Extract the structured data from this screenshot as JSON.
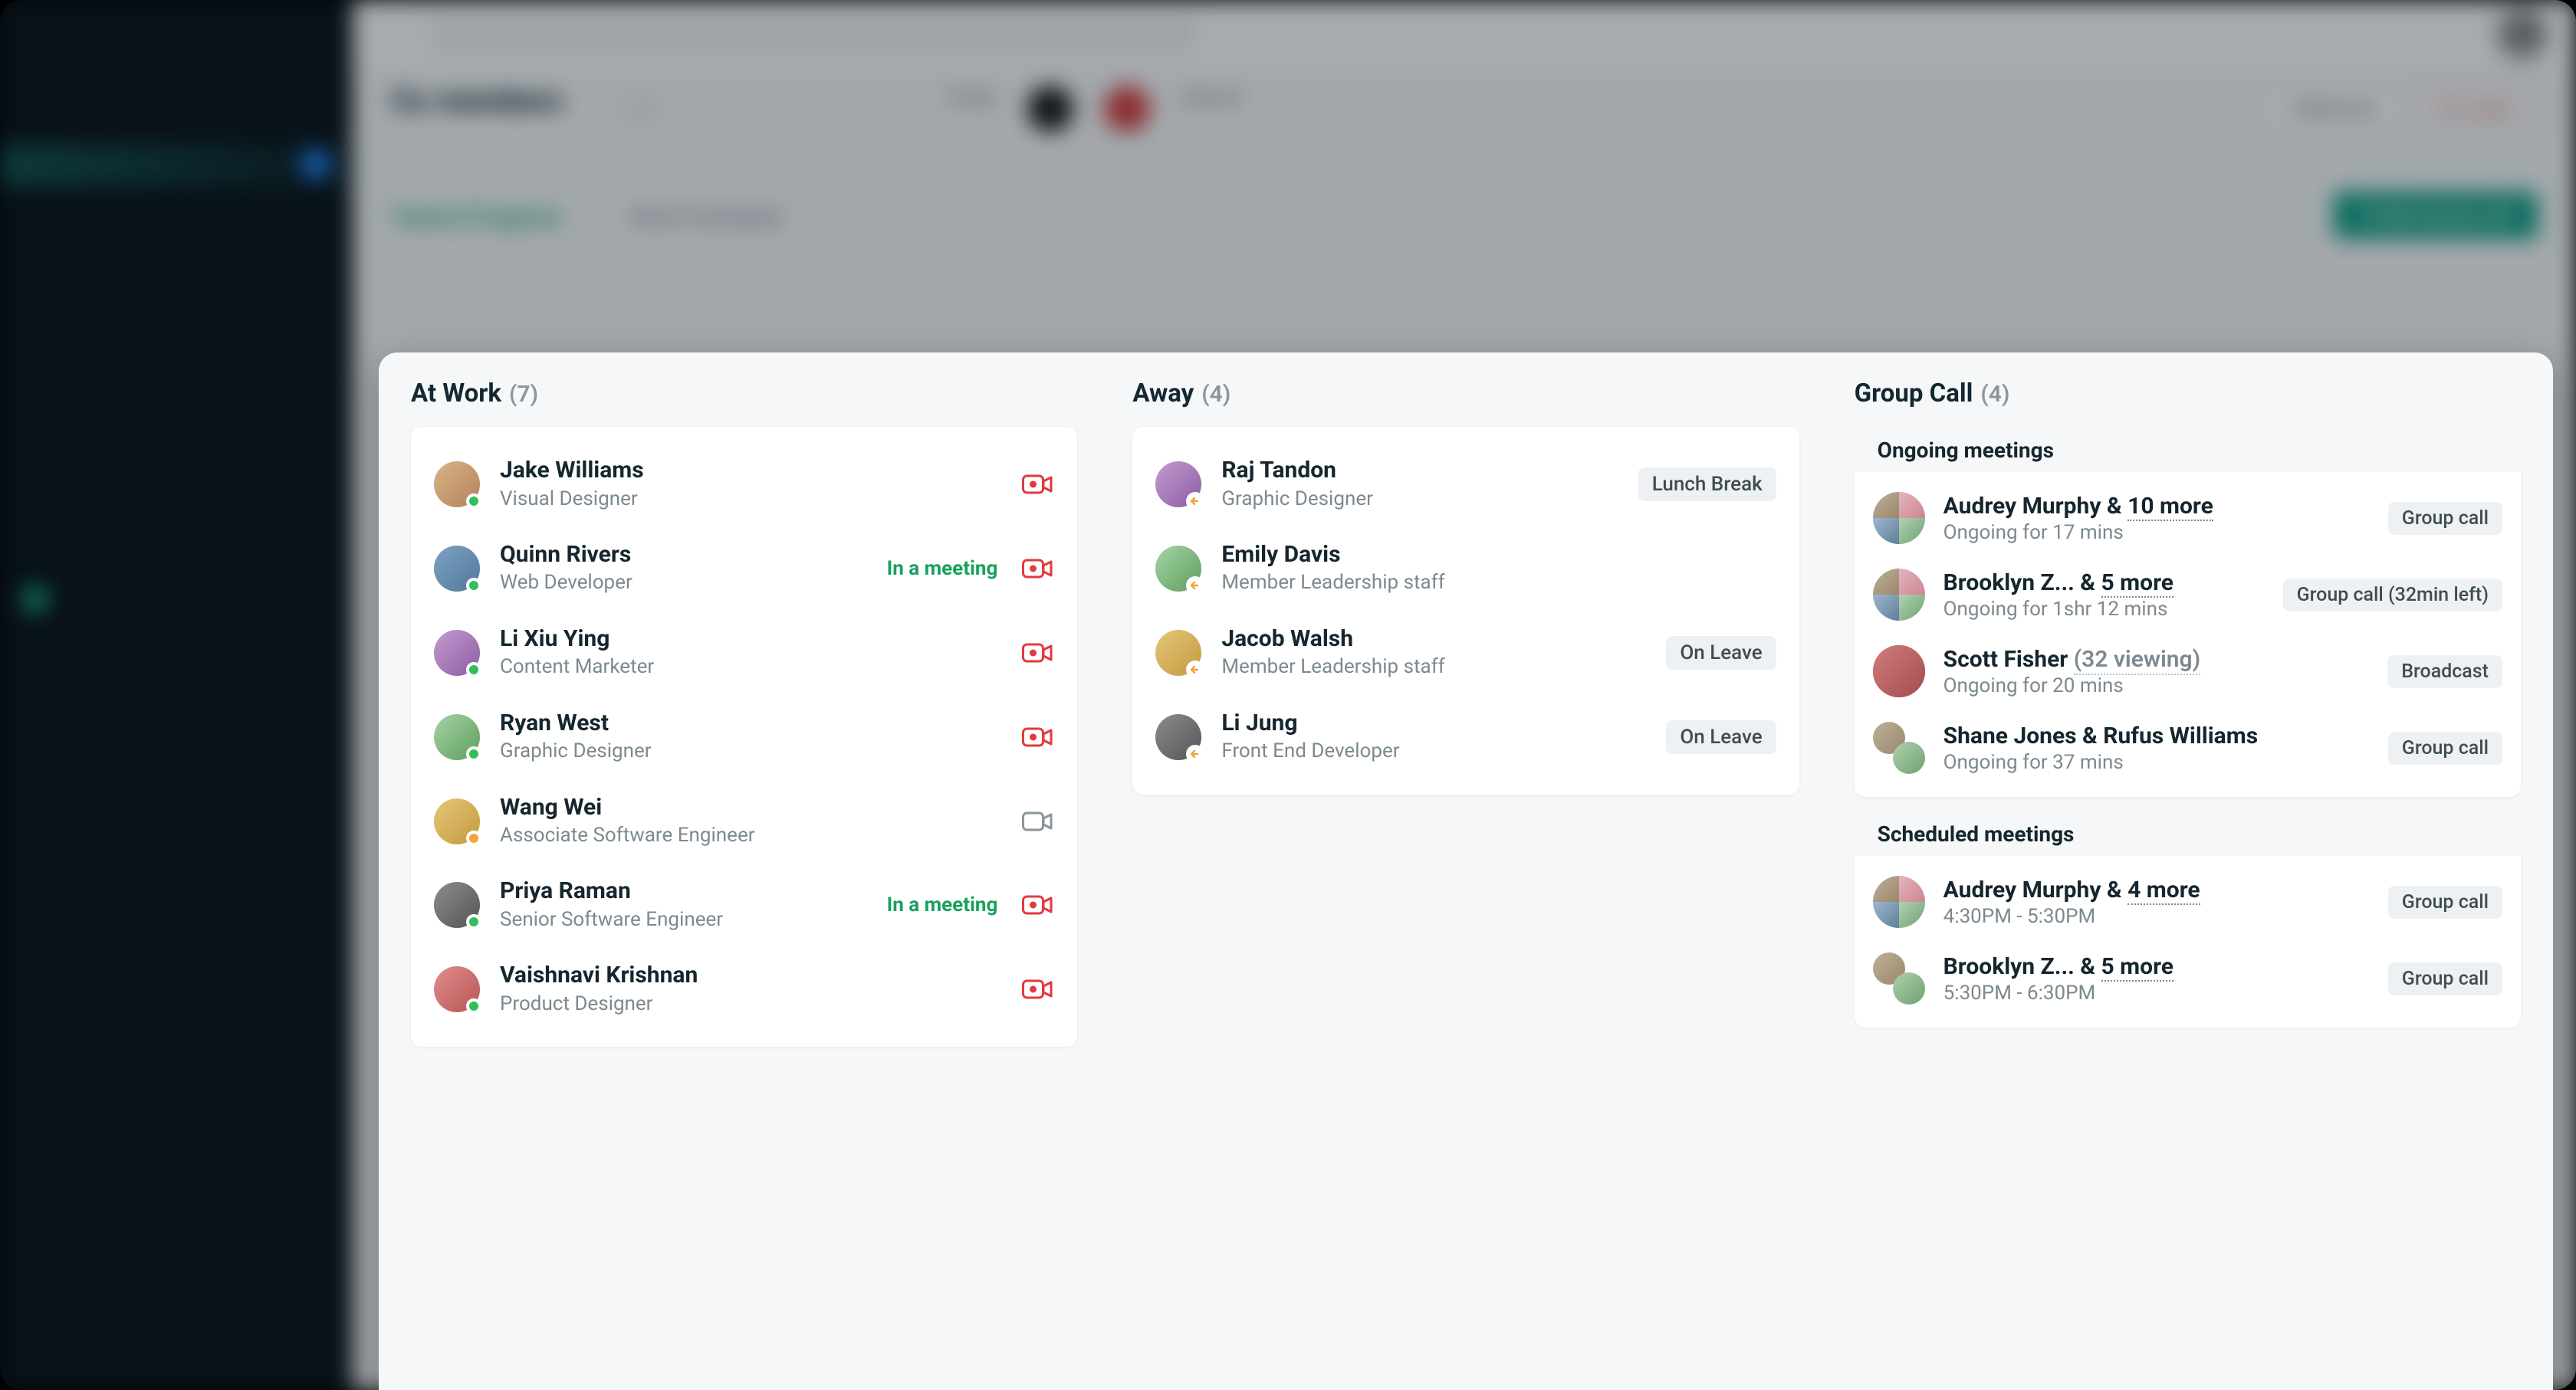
{
  "background": {
    "page_title": "Co-members",
    "labels": {
      "today": "Today",
      "absent": "Absent"
    },
    "tabs": {
      "active": "Team's Progress",
      "other": "Work Schedule"
    },
    "buttons": {
      "check_out": "Check-out",
      "on_leave": "On Leave",
      "cta": "Create group call"
    }
  },
  "columns": {
    "at_work": {
      "title": "At Work",
      "count": "(7)",
      "people": [
        {
          "name": "Jake Williams",
          "role": "Visual Designer",
          "status": "green",
          "meeting": false,
          "cam": "red"
        },
        {
          "name": "Quinn Rivers",
          "role": "Web Developer",
          "status": "green",
          "meeting": true,
          "cam": "red"
        },
        {
          "name": "Li Xiu Ying",
          "role": "Content Marketer",
          "status": "green",
          "meeting": false,
          "cam": "red"
        },
        {
          "name": "Ryan West",
          "role": "Graphic Designer",
          "status": "green",
          "meeting": false,
          "cam": "red"
        },
        {
          "name": "Wang Wei",
          "role": "Associate Software Engineer",
          "status": "orange",
          "meeting": false,
          "cam": "grey"
        },
        {
          "name": "Priya Raman",
          "role": "Senior Software Engineer",
          "status": "green",
          "meeting": true,
          "cam": "red"
        },
        {
          "name": "Vaishnavi Krishnan",
          "role": "Product Designer",
          "status": "green",
          "meeting": false,
          "cam": "red"
        }
      ],
      "meeting_label": "In a meeting"
    },
    "away": {
      "title": "Away",
      "count": "(4)",
      "people": [
        {
          "name": "Raj Tandon",
          "role": "Graphic Designer",
          "pill": "Lunch Break"
        },
        {
          "name": "Emily Davis",
          "role": "Member Leadership staff",
          "pill": ""
        },
        {
          "name": "Jacob Walsh",
          "role": "Member Leadership staff",
          "pill": "On Leave"
        },
        {
          "name": "Li Jung",
          "role": "Front End Developer",
          "pill": "On Leave"
        }
      ]
    },
    "group_call": {
      "title": "Group Call",
      "count": "(4)",
      "ongoing_title": "Ongoing meetings",
      "scheduled_title": "Scheduled meetings",
      "ongoing": [
        {
          "title_pre": "Audrey Murphy & ",
          "title_more": "10 more",
          "title_post": "",
          "sub": "Ongoing for 17 mins",
          "pill": "Group call",
          "avatars": "quad"
        },
        {
          "title_pre": "Brooklyn Z... & ",
          "title_more": "5 more",
          "title_post": "",
          "sub": "Ongoing for 1shr 12 mins",
          "pill": "Group call (32min left)",
          "avatars": "quad"
        },
        {
          "title_pre": "Scott Fisher ",
          "title_more": "",
          "title_post": "(32 viewing)",
          "sub": "Ongoing for 20 mins",
          "pill": "Broadcast",
          "avatars": "single"
        },
        {
          "title_pre": "Shane Jones & Rufus Williams",
          "title_more": "",
          "title_post": "",
          "sub": "Ongoing for 37 mins",
          "pill": "Group call",
          "avatars": "duo"
        }
      ],
      "scheduled": [
        {
          "title_pre": "Audrey Murphy & ",
          "title_more": "4 more",
          "title_post": "",
          "sub": "4:30PM - 5:30PM",
          "pill": "Group call",
          "avatars": "quad"
        },
        {
          "title_pre": "Brooklyn Z... & ",
          "title_more": "5 more",
          "title_post": "",
          "sub": "5:30PM - 6:30PM",
          "pill": "Group call",
          "avatars": "duo"
        }
      ]
    }
  }
}
